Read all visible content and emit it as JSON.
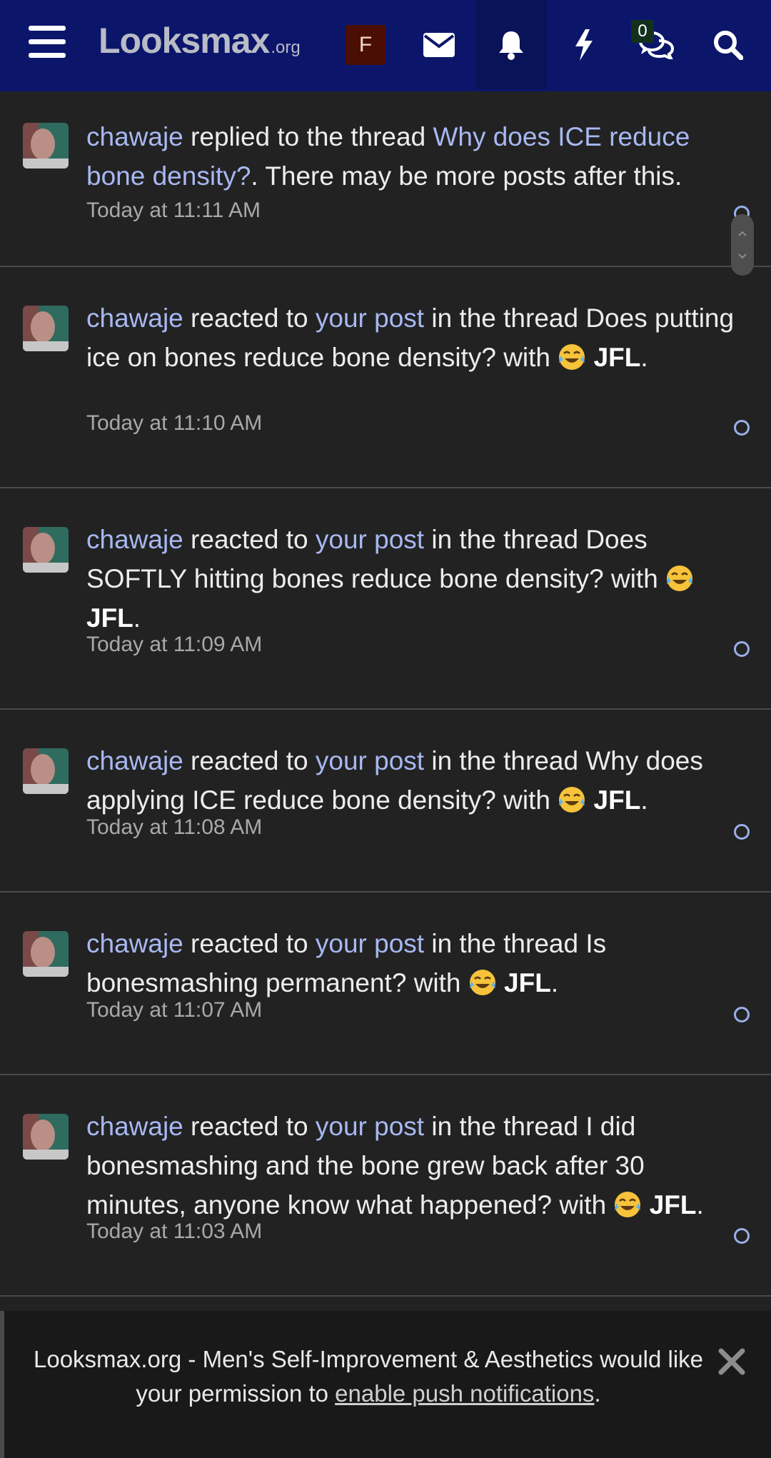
{
  "header": {
    "logo_main": "Looksmax",
    "logo_suffix": ".org",
    "user_initial": "F",
    "conversations_badge": "0",
    "icons": [
      "menu-icon",
      "envelope-icon",
      "bell-icon",
      "bolt-icon",
      "chat-bubbles-icon",
      "search-icon"
    ],
    "colors": {
      "background": "#0b166b",
      "logo": "#b9bbc6"
    }
  },
  "notifications": [
    {
      "user": "chawaje",
      "parts": [
        " replied to the thread ",
        "Why does ICE reduce bone density?",
        ". There may be more posts after this."
      ],
      "time": "Today at 11:11 AM"
    },
    {
      "user": "chawaje",
      "action": " reacted to ",
      "post_link": "your post",
      "thread_text": " in the thread Does putting ice on bones reduce bone density? with ",
      "reaction": "JFL",
      "end": ".",
      "time": "Today at 11:10 AM"
    },
    {
      "user": "chawaje",
      "action": " reacted to ",
      "post_link": "your post",
      "thread_text": " in the thread Does SOFTLY hitting bones reduce bone density? with ",
      "reaction": "JFL",
      "end": ".",
      "time": "Today at 11:09 AM"
    },
    {
      "user": "chawaje",
      "action": " reacted to ",
      "post_link": "your post",
      "thread_text": " in the thread Why does applying ICE reduce bone density? with ",
      "reaction": "JFL",
      "end": ".",
      "time": "Today at 11:08 AM"
    },
    {
      "user": "chawaje",
      "action": " reacted to ",
      "post_link": "your post",
      "thread_text": " in the thread Is bonesmashing permanent? with ",
      "reaction": "JFL",
      "end": ".",
      "time": "Today at 11:07 AM"
    },
    {
      "user": "chawaje",
      "action": " reacted to ",
      "post_link": "your post",
      "thread_text": " in the thread I did bonesmashing and the bone grew back after 30 minutes, anyone know what happened? with ",
      "reaction": "JFL",
      "end": ".",
      "time": "Today at 11:03 AM"
    }
  ],
  "push_banner": {
    "text_before": "Looksmax.org - Men's Self-Improvement & Aesthetics would like your permission to ",
    "link": "enable push notifications",
    "text_after": "."
  },
  "colors": {
    "link": "#a7b8f2",
    "page_bg": "#222222"
  }
}
